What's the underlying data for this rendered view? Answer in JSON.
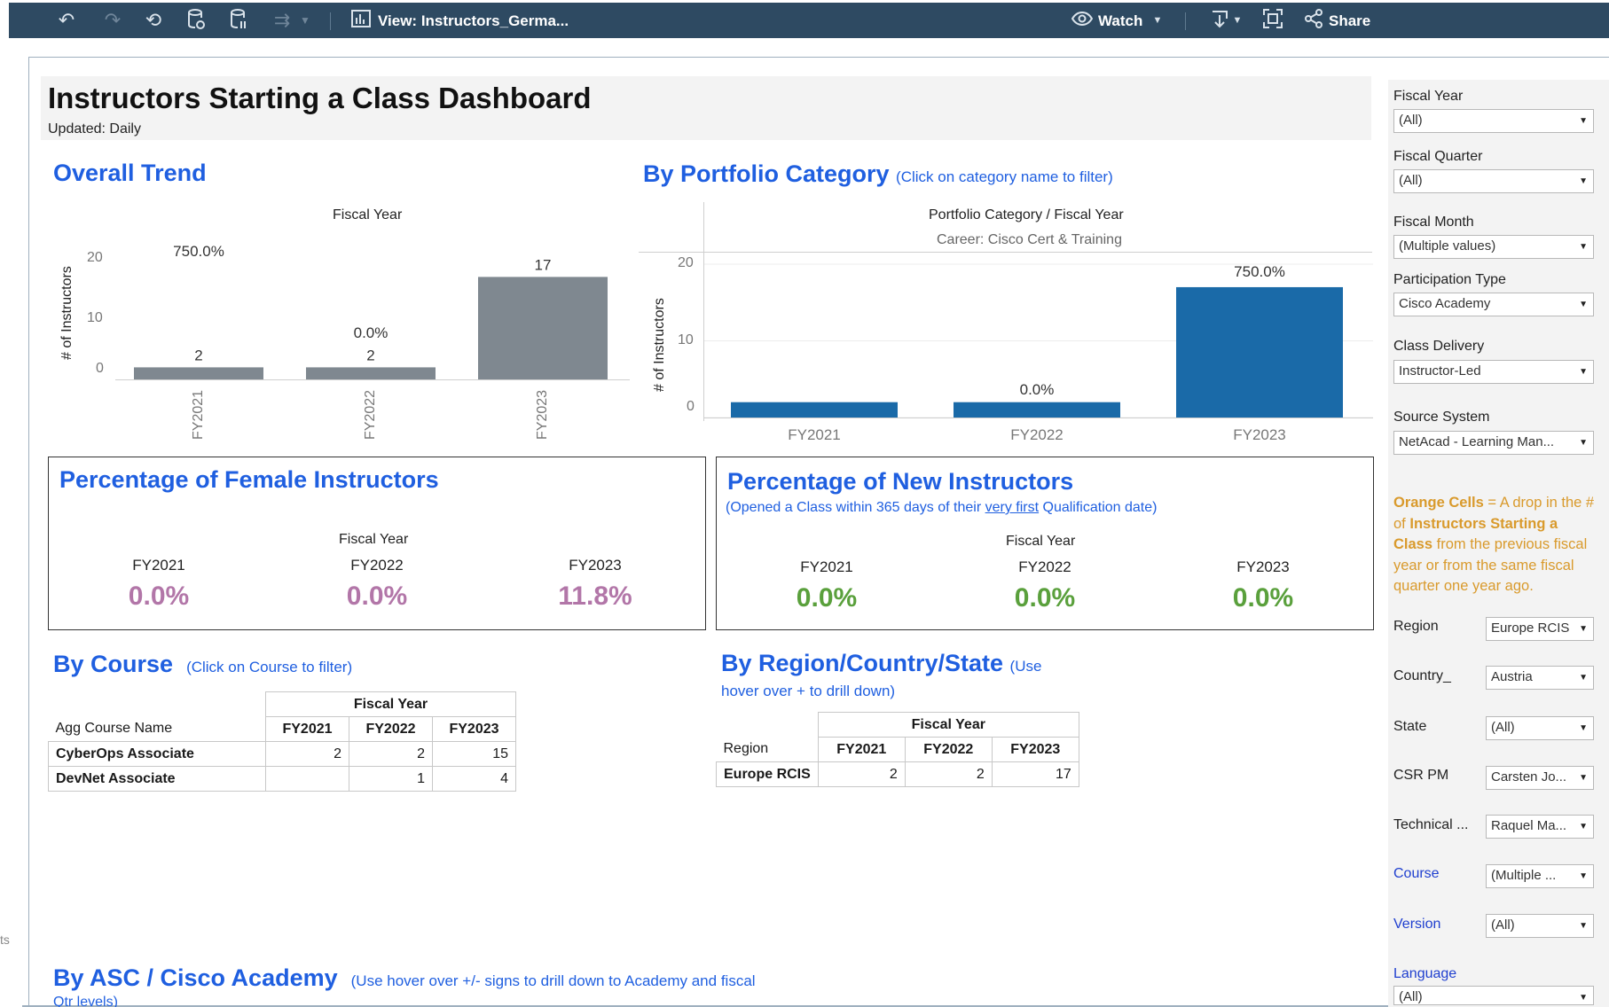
{
  "toolbar": {
    "view_label": "View: Instructors_Germa...",
    "watch_label": "Watch",
    "share_label": "Share"
  },
  "header": {
    "title": "Instructors Starting a Class Dashboard",
    "updated": "Updated: Daily"
  },
  "overall_trend": {
    "title": "Overall Trend",
    "header": "Fiscal Year",
    "ylabel": "# of Instructors",
    "ticks": [
      "20",
      "10",
      "0"
    ],
    "categories": [
      "FY2021",
      "FY2022",
      "FY2023"
    ],
    "pct_labels": [
      "",
      "0.0%",
      "750.0%"
    ],
    "value_labels": [
      "2",
      "2",
      "17"
    ]
  },
  "portfolio": {
    "title": "By Portfolio Category",
    "note": "(Click on category name to filter)",
    "header": "Portfolio Category / Fiscal Year",
    "category": "Career: Cisco Cert & Training",
    "ylabel": "# of Instructors",
    "ticks": [
      "20",
      "10",
      "0"
    ],
    "categories": [
      "FY2021",
      "FY2022",
      "FY2023"
    ],
    "pct_labels": [
      "",
      "0.0%",
      "750.0%"
    ]
  },
  "chart_data": [
    {
      "type": "bar",
      "title": "Overall Trend",
      "xlabel": "Fiscal Year",
      "ylabel": "# of Instructors",
      "categories": [
        "FY2021",
        "FY2022",
        "FY2023"
      ],
      "values": [
        2,
        2,
        17
      ],
      "pct_change": [
        "",
        "0.0%",
        "750.0%"
      ],
      "ylim": [
        0,
        20
      ],
      "color": "#7f8890"
    },
    {
      "type": "bar",
      "title": "By Portfolio Category",
      "xlabel": "Portfolio Category / Fiscal Year",
      "ylabel": "# of Instructors",
      "group": "Career: Cisco Cert & Training",
      "categories": [
        "FY2021",
        "FY2022",
        "FY2023"
      ],
      "values": [
        2,
        2,
        17
      ],
      "pct_change": [
        "",
        "0.0%",
        "750.0%"
      ],
      "ylim": [
        0,
        20
      ],
      "color": "#1a6aa8"
    }
  ],
  "female": {
    "title": "Percentage of Female Instructors",
    "header": "Fiscal Year",
    "cols": [
      "FY2021",
      "FY2022",
      "FY2023"
    ],
    "values": [
      "0.0%",
      "0.0%",
      "11.8%"
    ],
    "color": "#b276a8"
  },
  "new_instr": {
    "title": "Percentage of New Instructors",
    "sub_a": "(Opened a Class within 365 days of their ",
    "sub_link": "very first",
    "sub_b": " Qualification date)",
    "header": "Fiscal Year",
    "cols": [
      "FY2021",
      "FY2022",
      "FY2023"
    ],
    "values": [
      "0.0%",
      "0.0%",
      "0.0%"
    ],
    "color": "#5aa03c"
  },
  "by_course": {
    "title": "By Course",
    "note": "(Click on Course to filter)",
    "header": "Fiscal Year",
    "row_header": "Agg Course Name",
    "cols": [
      "FY2021",
      "FY2022",
      "FY2023"
    ],
    "rows": [
      {
        "name": "CyberOps Associate",
        "values": [
          "2",
          "2",
          "15"
        ]
      },
      {
        "name": "DevNet Associate",
        "values": [
          "",
          "1",
          "4"
        ]
      }
    ]
  },
  "by_region": {
    "title": "By Region/Country/State",
    "note1": "(Use",
    "note2": "hover over + to drill down)",
    "header": "Fiscal Year",
    "row_header": "Region",
    "cols": [
      "FY2021",
      "FY2022",
      "FY2023"
    ],
    "rows": [
      {
        "name": "Europe RCIS",
        "values": [
          "2",
          "2",
          "17"
        ]
      }
    ]
  },
  "by_asc": {
    "title": "By ASC / Cisco Academy",
    "note": "(Use hover over +/- signs to drill down to Academy and fiscal",
    "note2": "Qtr levels)"
  },
  "filters": {
    "fiscal_year": {
      "label": "Fiscal Year",
      "value": "(All)"
    },
    "fiscal_quarter": {
      "label": "Fiscal Quarter",
      "value": "(All)"
    },
    "fiscal_month": {
      "label": "Fiscal Month",
      "value": "(Multiple values)"
    },
    "participation": {
      "label": "Participation Type",
      "value": "Cisco Academy"
    },
    "class_delivery": {
      "label": "Class Delivery",
      "value": "Instructor-Led"
    },
    "source_system": {
      "label": "Source System",
      "value": "NetAcad - Learning Man..."
    },
    "region": {
      "label": "Region",
      "value": "Europe RCIS"
    },
    "country": {
      "label": "Country_",
      "value": "Austria"
    },
    "state": {
      "label": "State",
      "value": "(All)"
    },
    "csr_pm": {
      "label": "CSR PM",
      "value": "Carsten Jo..."
    },
    "technical": {
      "label": "Technical ...",
      "value": "Raquel Ma..."
    },
    "course": {
      "label": "Course",
      "value": "(Multiple ..."
    },
    "version": {
      "label": "Version",
      "value": "(All)"
    },
    "language": {
      "label": "Language",
      "value": "(All)"
    }
  },
  "legend_note": {
    "a": "Orange Cells",
    "b": " = A drop in the # of ",
    "c": "Instructors Starting a Class",
    "d": " from the previous fiscal year or from the same fiscal quarter one year ago."
  },
  "stray_text": "ts"
}
